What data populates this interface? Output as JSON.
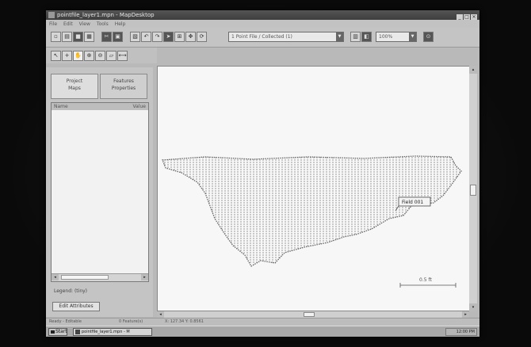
{
  "window": {
    "title": "pointfile_layer1.mpn - MapDesktop",
    "controls": [
      "_",
      "□",
      "×"
    ]
  },
  "menu": {
    "items": [
      "File",
      "Edit",
      "View",
      "Tools",
      "Help"
    ]
  },
  "toolbar": {
    "layer_combo": "1 Point File / Collected (1)",
    "zoom_combo": "100%",
    "combo_arrow": "▼"
  },
  "left_panel": {
    "tabs": [
      {
        "label_line1": "Project",
        "label_line2": "Maps"
      },
      {
        "label_line1": "Features",
        "label_line2": "Properties"
      }
    ],
    "list": {
      "col1": "Name",
      "col2": "Value"
    },
    "legend_label": "Legend: (tiny)",
    "button_label": "Edit Attributes"
  },
  "map": {
    "point_label": "Field 001",
    "scale_label": "0.5 ft"
  },
  "statusbar": {
    "segments": [
      "Ready - Editable",
      "0 Feature(s)",
      "X: 127.34  Y: 0.8561"
    ]
  },
  "taskbar": {
    "start_label": "Start",
    "task_label": "pointfile_layer1.mpn - M",
    "tray_time": "12:00 PM"
  }
}
